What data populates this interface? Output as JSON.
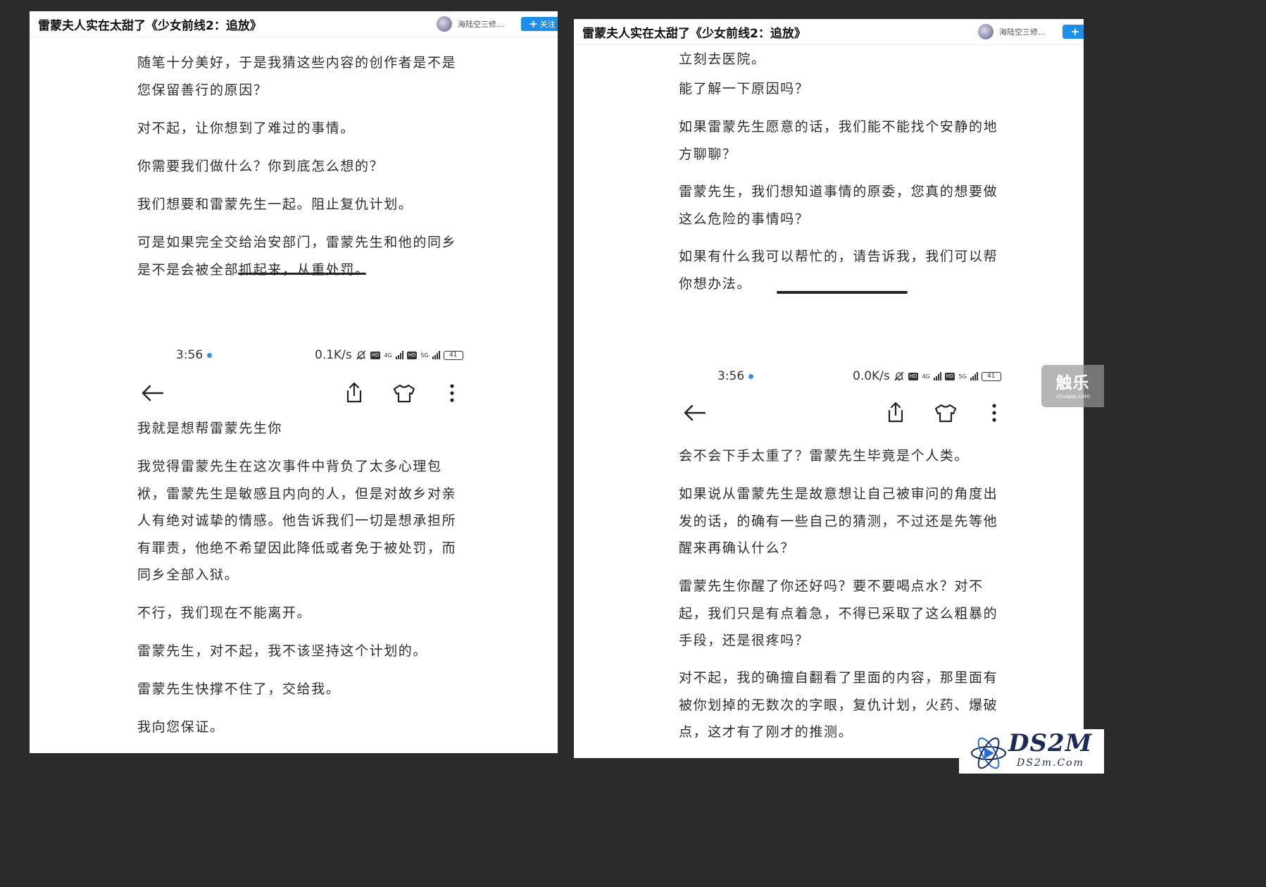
{
  "left": {
    "title": "雷蒙夫人实在太甜了《少女前线2：追放》",
    "user": "海陆空三修…",
    "follow": "关注",
    "top_paragraphs": [
      "随笔十分美好，于是我猜这些内容的创作者是不是\n您保留善行的原因？",
      "对不起，让你想到了难过的事情。",
      "你需要我们做什么？你到底怎么想的？",
      "我们想要和雷蒙先生一起。阻止复仇计划。",
      "可是如果完全交给治安部门，雷蒙先生和他的同乡\n是不是会被全部抓起来，从重处罚。"
    ],
    "status": {
      "time": "3:56",
      "speed": "0.1K/s",
      "net1": "4G",
      "net2": "5G",
      "battery": "41"
    },
    "bottom_paragraphs": [
      "我就是想帮雷蒙先生你",
      "我觉得雷蒙先生在这次事件中背负了太多心理包\n袱，雷蒙先生是敏感且内向的人，但是对故乡对亲\n人有绝对诚挚的情感。他告诉我们一切是想承担所\n有罪责，他绝不希望因此降低或者免于被处罚，而\n同乡全部入狱。",
      "不行，我们现在不能离开。",
      "雷蒙先生，对不起，我不该坚持这个计划的。",
      "雷蒙先生快撑不住了，交给我。",
      "我向您保证。"
    ]
  },
  "right": {
    "title": "雷蒙夫人实在太甜了《少女前线2：追放》",
    "user": "海陆空三修…",
    "top_paragraphs": [
      "立刻去医院。",
      "能了解一下原因吗？",
      "如果雷蒙先生愿意的话，我们能不能找个安静的地\n方聊聊？",
      "雷蒙先生，我们想知道事情的原委，您真的想要做\n这么危险的事情吗？",
      "如果有什么我可以帮忙的，请告诉我，我们可以帮\n你想办法。"
    ],
    "status": {
      "time": "3:56",
      "speed": "0.0K/s",
      "net1": "4G",
      "net2": "5G",
      "battery": "41"
    },
    "bottom_paragraphs": [
      "会不会下手太重了？雷蒙先生毕竟是个人类。",
      "如果说从雷蒙先生是故意想让自己被审问的角度出\n发的话，的确有一些自己的猜测，不过还是先等他\n醒来再确认什么？",
      "雷蒙先生你醒了你还好吗？要不要喝点水？对不\n起，我们只是有点着急，不得已采取了这么粗暴的\n手段，还是很疼吗？",
      "对不起，我的确擅自翻看了里面的内容，那里面有\n被你划掉的无数次的字眼，复仇计划，火药、爆破\n点，这才有了刚才的推测。"
    ]
  },
  "watermark": {
    "chuapp_big": "触乐",
    "chuapp_small": "chuapp.com",
    "ds2m_big": "DS2M",
    "ds2m_small": "DS2m.Com"
  },
  "colors": {
    "background": "#2b2b2b",
    "page": "#ffffff",
    "text": "#2d2d2d",
    "accent": "#1f8ee8"
  },
  "icons": [
    "back-arrow-icon",
    "share-icon",
    "tshirt-icon",
    "more-vertical-icon",
    "mute-bell-icon",
    "avatar"
  ]
}
